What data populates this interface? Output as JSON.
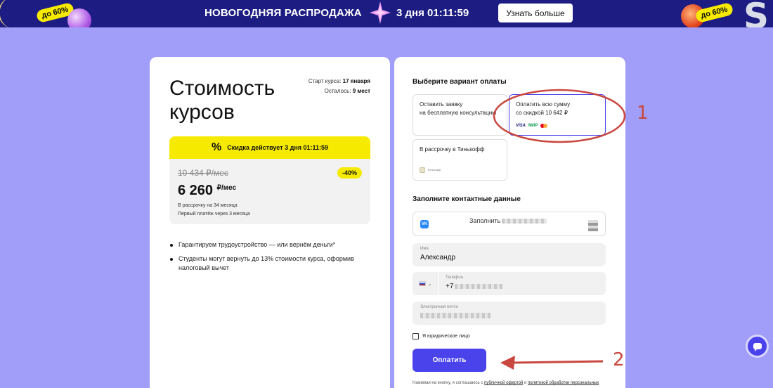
{
  "banner": {
    "title": "НОВОГОДНЯЯ РАСПРОДАЖА",
    "timer": "3 дня 01:11:59",
    "more_button": "Узнать больше",
    "badge_left": "до 60%",
    "badge_right": "до 60%"
  },
  "course": {
    "title": "Стоимость курсов",
    "start_label": "Старт курса:",
    "start_value": "17 января",
    "seats_label": "Осталось:",
    "seats_value": "9 мест",
    "discount_strip": "Скидка действует 3 дня 01:11:59",
    "old_price": "10 434 ₽/мес",
    "discount_badge": "-40%",
    "new_price": "6 260",
    "new_price_unit": "₽/мес",
    "installment_note": "В рассрочку на 34 месяца",
    "first_payment_note": "Первый платёж через 3 месяца",
    "benefits": [
      "Гарантируем трудоустройство — или вернём деньги*",
      "Студенты могут вернуть до 13% стоимости курса, оформив налоговый вычет"
    ]
  },
  "payment": {
    "section_title": "Выберите вариант оплаты",
    "options": [
      {
        "line1": "Оставить заявку",
        "line2": "на бесплатную консультацию"
      },
      {
        "line1": "Оплатить всю сумму",
        "line2": "со скидкой 10 642 ₽",
        "logos": [
          "VISA",
          "МИР"
        ]
      },
      {
        "line1": "В рассрочку в Тинькофф",
        "line2": "",
        "logo_text": "Тинькофф"
      }
    ]
  },
  "contacts": {
    "section_title": "Заполните контактные данные",
    "vk_label": "Заполнить",
    "name_label": "Имя",
    "name_value": "Александр",
    "phone_label": "Телефон",
    "phone_prefix": "+7",
    "email_label": "Электронная почта",
    "legal_entity": "Я юридическое лицо",
    "pay_button": "Оплатить",
    "consent_prefix": "Нажимая на кнопку, я соглашаюсь с",
    "consent_offer": "публичной офертой",
    "consent_and": "и",
    "consent_policy": "политикой обработки персональных данных"
  },
  "annotations": {
    "marker1": "1",
    "marker2": "2"
  },
  "colors": {
    "accent": "#4a43ec",
    "background": "#a19ef9",
    "banner": "#1c1c82",
    "yellow": "#f6ea00",
    "annotation": "#c9473f"
  },
  "icons": [
    "percent-icon",
    "vk-icon",
    "russia-flag-icon",
    "chevron-down-icon",
    "chat-icon",
    "star-icon"
  ]
}
